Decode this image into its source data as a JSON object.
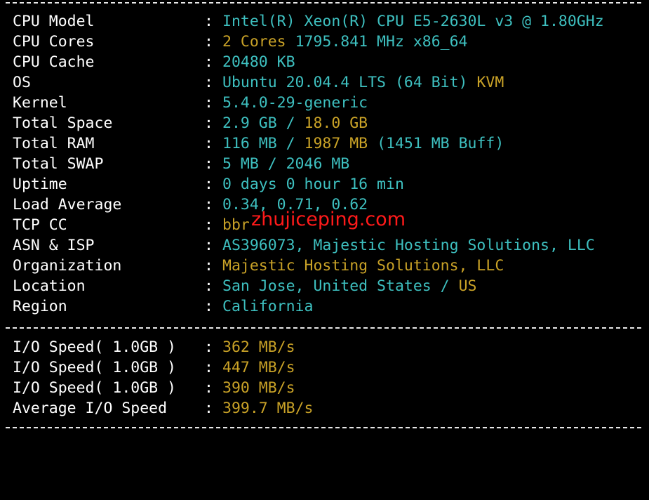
{
  "colors": {
    "background": "#000000",
    "label": "#ffffff",
    "cyan_value": "#3ec0c0",
    "yellow_value": "#c9a227",
    "watermark": "#ff1a1a",
    "separator": "#e8e8e8"
  },
  "colon": ":",
  "system_info": [
    {
      "label": "CPU Model",
      "value": "Intel(R) Xeon(R) CPU E5-2630L v3 @ 1.80GHz"
    },
    {
      "label": "CPU Cores",
      "value": "2 Cores",
      "value2": "1795.841 MHz x86_64"
    },
    {
      "label": "CPU Cache",
      "value": "20480 KB"
    },
    {
      "label": "OS",
      "value": "Ubuntu 20.04.4 LTS (64 Bit)",
      "value2": "KVM"
    },
    {
      "label": "Kernel",
      "value": "5.4.0-29-generic"
    },
    {
      "label": "Total Space",
      "value": "2.9 GB /",
      "value2": "18.0 GB"
    },
    {
      "label": "Total RAM",
      "value": "116 MB /",
      "value2": "1987 MB",
      "value3": "(1451 MB Buff)"
    },
    {
      "label": "Total SWAP",
      "value": "5 MB / 2046 MB"
    },
    {
      "label": "Uptime",
      "value": "0 days 0 hour 16 min"
    },
    {
      "label": "Load Average",
      "value": "0.34, 0.71, 0.62"
    },
    {
      "label": "TCP CC",
      "value": "bbr"
    },
    {
      "label": "ASN & ISP",
      "value": "AS396073, Majestic Hosting Solutions, LLC"
    },
    {
      "label": "Organization",
      "value": "Majestic Hosting Solutions, LLC"
    },
    {
      "label": "Location",
      "value": "San Jose, United States /",
      "value2": "US"
    },
    {
      "label": "Region",
      "value": "California"
    }
  ],
  "io_speed": [
    {
      "label": "I/O Speed( 1.0GB )",
      "value": "362 MB/s"
    },
    {
      "label": "I/O Speed( 1.0GB )",
      "value": "447 MB/s"
    },
    {
      "label": "I/O Speed( 1.0GB )",
      "value": "390 MB/s"
    },
    {
      "label": "Average I/O Speed",
      "value": "399.7 MB/s"
    }
  ],
  "watermark_text": "zhujiceping.com"
}
